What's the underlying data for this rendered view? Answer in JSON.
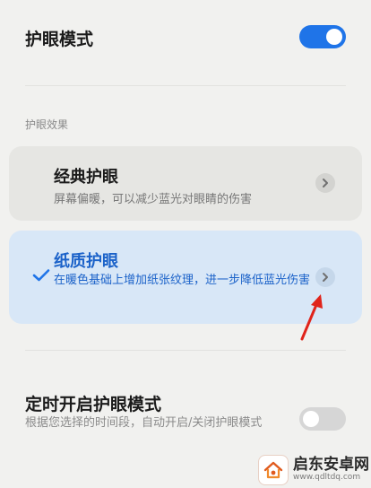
{
  "eye_protection": {
    "label": "护眼模式",
    "enabled": true
  },
  "effects_section": {
    "label": "护眼效果"
  },
  "effects": [
    {
      "title": "经典护眼",
      "description": "屏幕偏暖，可以减少蓝光对眼睛的伤害",
      "selected": false
    },
    {
      "title": "纸质护眼",
      "description": "在暖色基础上增加纸张纹理，进一步降低蓝光伤害",
      "selected": true
    }
  ],
  "schedule": {
    "label": "定时开启护眼模式",
    "description": "根据您选择的时间段，自动开启/关闭护眼模式",
    "enabled": false
  },
  "watermark": {
    "title": "启东安卓网",
    "url": "www.qdltdq.com"
  },
  "colors": {
    "background": "#f1f1ef",
    "accent": "#1f74e8",
    "card_default": "#e6e6e3",
    "card_selected": "#d8e7f7",
    "selected_text": "#1b62c9",
    "toggle_off": "#d6d6d6",
    "annotation_arrow": "#e0241b"
  },
  "icons": {
    "check": "check-icon",
    "chevron": "chevron-right-icon",
    "annotation": "red-arrow-icon",
    "watermark_logo": "home-logo-icon"
  }
}
